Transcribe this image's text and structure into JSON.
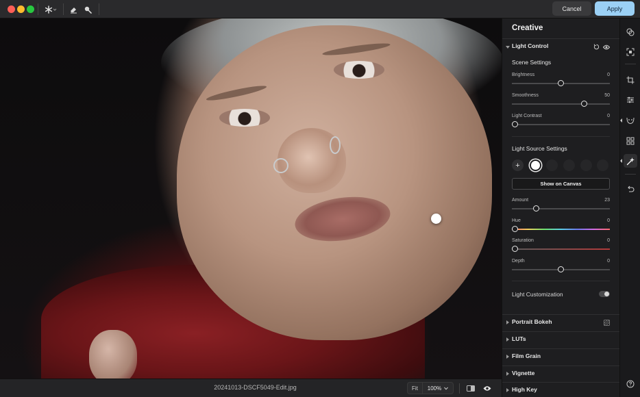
{
  "toolbar": {
    "cancel_label": "Cancel",
    "apply_label": "Apply",
    "tools": [
      "magic-wand-icon",
      "eraser-icon",
      "brush-icon"
    ]
  },
  "canvas": {
    "filename": "20241013-DSCF5049-Edit.jpg",
    "fit_label": "Fit",
    "zoom_label": "100%"
  },
  "panel": {
    "title": "Creative",
    "light_control": {
      "label": "Light Control",
      "scene_settings_label": "Scene Settings",
      "brightness": {
        "label": "Brightness",
        "value": "0",
        "level": 0.5
      },
      "smoothness": {
        "label": "Smoothness",
        "value": "50",
        "level": 0.75
      },
      "light_contrast": {
        "label": "Light Contrast",
        "value": "0",
        "level": 0.0
      },
      "light_source_label": "Light Source Settings",
      "show_on_canvas_label": "Show on Canvas",
      "amount": {
        "label": "Amount",
        "value": "23",
        "level": 0.23
      },
      "hue": {
        "label": "Hue",
        "value": "0",
        "level": 0.0
      },
      "saturation": {
        "label": "Saturation",
        "value": "0",
        "level": 0.0
      },
      "depth": {
        "label": "Depth",
        "value": "0",
        "level": 0.5
      },
      "light_customization_label": "Light Customization",
      "light_customization_on": false
    },
    "sections": [
      "Portrait Bokeh",
      "LUTs",
      "Film Grain",
      "Vignette",
      "High Key"
    ]
  },
  "colors": {
    "accent": "#9bd0f5",
    "jacket": "#7a1a1c",
    "panel_bg": "#1e1e20"
  }
}
